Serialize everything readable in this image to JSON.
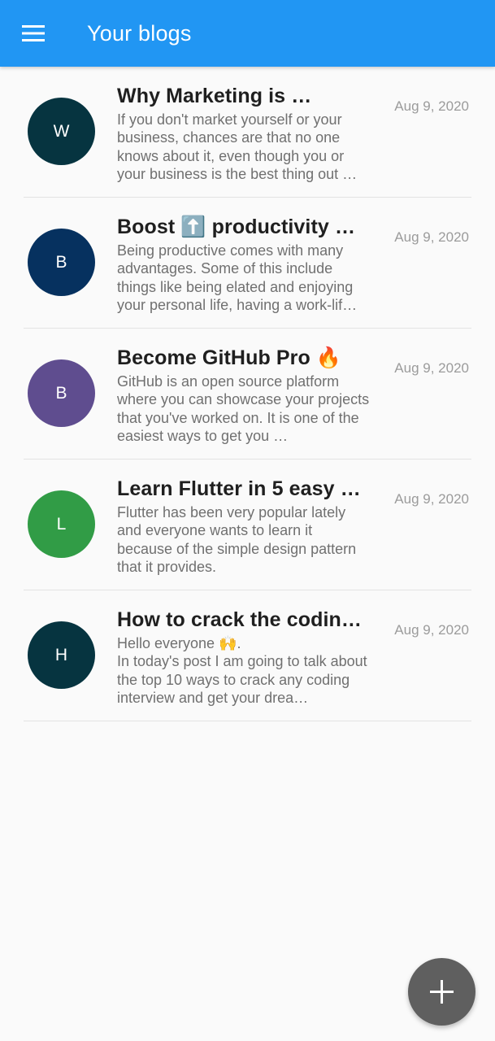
{
  "app_bar": {
    "title": "Your blogs",
    "background": "#2196f3",
    "menu_icon": "hamburger-menu-icon"
  },
  "blogs": [
    {
      "avatar_letter": "W",
      "avatar_color": "#063440",
      "title": "Why Marketing is …",
      "body": "If you don't market yourself or your business, chances are that no one knows about it, even though you or your business is the best thing out …",
      "date": "Aug 9, 2020"
    },
    {
      "avatar_letter": "B",
      "avatar_color": "#06315f",
      "title": "Boost ⬆️ productivity …",
      "body": "Being productive comes with many advantages. Some of this include things like being elated and enjoying your personal life, having a work-lif…",
      "date": "Aug 9, 2020"
    },
    {
      "avatar_letter": "B",
      "avatar_color": "#5f4d8f",
      "title": "Become GitHub Pro 🔥",
      "body": "GitHub is an open source platform where you can showcase your projects that you've worked on. It is one of the easiest ways to get you …",
      "date": "Aug 9, 2020"
    },
    {
      "avatar_letter": "L",
      "avatar_color": "#319c46",
      "title": "Learn Flutter in 5 easy …",
      "body": "Flutter has been very popular lately and everyone wants to learn it because of the simple design pattern that it provides.",
      "date": "Aug 9, 2020"
    },
    {
      "avatar_letter": "H",
      "avatar_color": "#063440",
      "title": "How to crack the coding …",
      "body": "Hello everyone 🙌.\nIn today's post I am going to talk about the top 10 ways to crack any coding interview and get your drea…",
      "date": "Aug 9, 2020"
    }
  ],
  "fab": {
    "icon": "plus-icon",
    "color": "#5f5f5f"
  }
}
